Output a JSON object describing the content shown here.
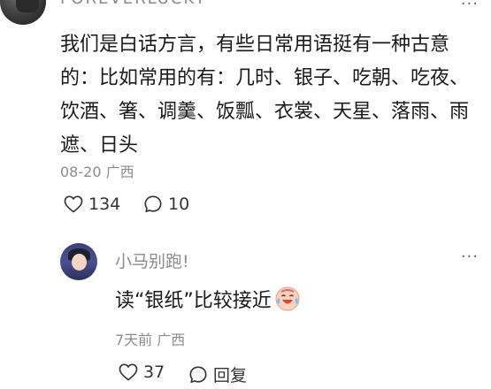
{
  "comment": {
    "username": "FOREVERLUCKY",
    "text": "我们是白话方言，有些日常用语挺有一种古意的：比如常用的有：几时、银子、吃朝、吃夜、饮酒、箸、调羹、饭瓢、衣裳、天星、落雨、雨遮、日头",
    "date": "08-20",
    "location": "广西",
    "like_count": "134",
    "reply_count": "10",
    "more_label": "···"
  },
  "reply": {
    "username": "小马别跑!",
    "text": "读“银纸”比较接近",
    "emoji": "laughing-tears-emoji",
    "time": "7天前",
    "location": "广西",
    "like_count": "37",
    "reply_label": "回复",
    "more_label": "···"
  },
  "icons": {
    "like": "heart-outline-icon",
    "comment": "speech-bubble-icon",
    "more": "more-dots-icon"
  }
}
